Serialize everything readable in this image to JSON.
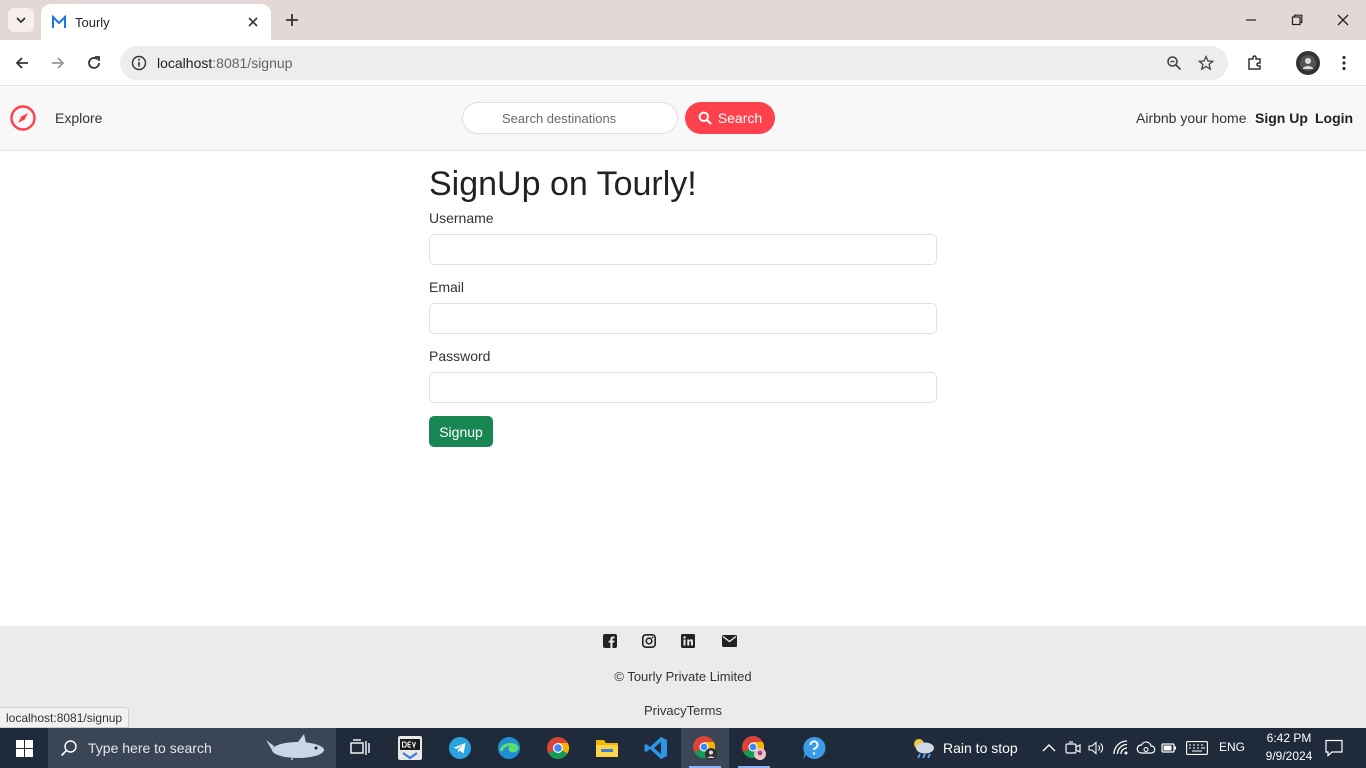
{
  "browser": {
    "tab": {
      "title": "Tourly"
    },
    "address_bar": {
      "host": "localhost",
      "path": ":8081/signup"
    }
  },
  "navbar": {
    "explore_label": "Explore",
    "search_placeholder": "Search destinations",
    "search_button_label": "Search",
    "airbnb_label": "Airbnb your home",
    "signup_label": "Sign Up",
    "login_label": "Login"
  },
  "form": {
    "title": "SignUp on Tourly!",
    "username_label": "Username",
    "username_value": "",
    "email_label": "Email",
    "email_value": "",
    "password_label": "Password",
    "password_value": "",
    "submit_label": "Signup"
  },
  "footer": {
    "social_icons": [
      "facebook-icon",
      "instagram-icon",
      "linkedin-icon",
      "envelope-icon"
    ],
    "copyright": "© Tourly Private Limited",
    "links": "PrivacyTerms"
  },
  "status_bar": {
    "url": "localhost:8081/signup"
  },
  "taskbar": {
    "search_placeholder": "Type here to search",
    "weather": "Rain to stop",
    "language": "ENG",
    "time": "6:42 PM",
    "date": "9/9/2024"
  },
  "colors": {
    "brand": "#fe424d",
    "signup_button": "#198754",
    "taskbar": "#1f2a3a"
  }
}
